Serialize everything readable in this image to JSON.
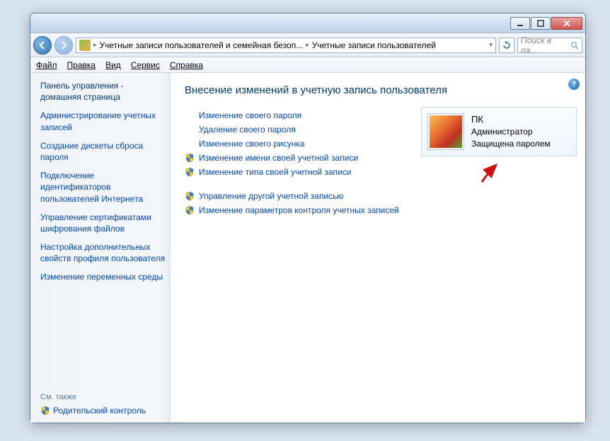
{
  "titlebar": {
    "min": "—",
    "max": "▢",
    "close": "✕"
  },
  "breadcrumb": {
    "part1": "Учетные записи пользователей и семейная безоп...",
    "part2": "Учетные записи пользователей"
  },
  "search": {
    "placeholder": "Поиск в па..."
  },
  "menu": {
    "file": "Файл",
    "edit": "Правка",
    "view": "Вид",
    "tools": "Сервис",
    "help": "Справка"
  },
  "sidebar": {
    "home": "Панель управления - домашняя страница",
    "items": [
      "Администрирование учетных записей",
      "Создание дискеты сброса пароля",
      "Подключение идентификаторов пользователей Интернета",
      "Управление сертификатами шифрования файлов",
      "Настройка дополнительных свойств профиля пользователя",
      "Изменение переменных среды"
    ],
    "see_also": "См. также",
    "parental": "Родительский контроль"
  },
  "main": {
    "heading": "Внесение изменений в учетную запись пользователя",
    "group1": [
      {
        "label": "Изменение своего пароля",
        "shield": false
      },
      {
        "label": "Удаление своего пароля",
        "shield": false
      },
      {
        "label": "Изменение своего рисунка",
        "shield": false
      },
      {
        "label": "Изменение имени своей учетной записи",
        "shield": true
      },
      {
        "label": "Изменение типа своей учетной записи",
        "shield": true
      }
    ],
    "group2": [
      {
        "label": "Управление другой учетной записью",
        "shield": true
      },
      {
        "label": "Изменение параметров контроля учетных записей",
        "shield": true
      }
    ]
  },
  "account": {
    "name": "ПК",
    "role": "Администратор",
    "status": "Защищена паролем"
  },
  "help": "?"
}
